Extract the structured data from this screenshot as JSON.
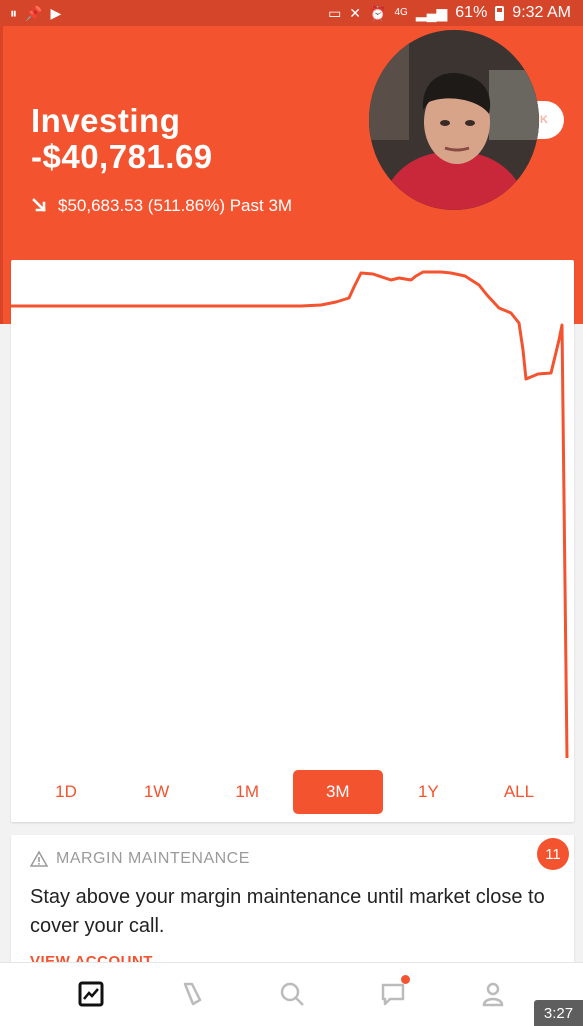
{
  "status_bar": {
    "battery": "61%",
    "time": "9:32 AM",
    "network": "4G"
  },
  "header": {
    "title": "Investing",
    "portfolio_value": "-$40,781.69",
    "change_text": "$50,683.53 (511.86%) Past 3M",
    "pill_text": "E STOCK",
    "brand_color": "#f4532f"
  },
  "chart": {
    "line_color": "#f4532f",
    "ranges": [
      {
        "label": "1D",
        "active": false
      },
      {
        "label": "1W",
        "active": false
      },
      {
        "label": "1M",
        "active": false
      },
      {
        "label": "3M",
        "active": true
      },
      {
        "label": "1Y",
        "active": false
      },
      {
        "label": "ALL",
        "active": false
      }
    ]
  },
  "alert": {
    "title": "MARGIN MAINTENANCE",
    "badge": "11",
    "message": "Stay above your margin maintenance until market close to cover your call.",
    "link": "VIEW ACCOUNT"
  },
  "nav": {
    "items": [
      "home-icon",
      "tag-icon",
      "search-icon",
      "messages-icon",
      "account-icon"
    ]
  },
  "video_timestamp": "3:27"
}
